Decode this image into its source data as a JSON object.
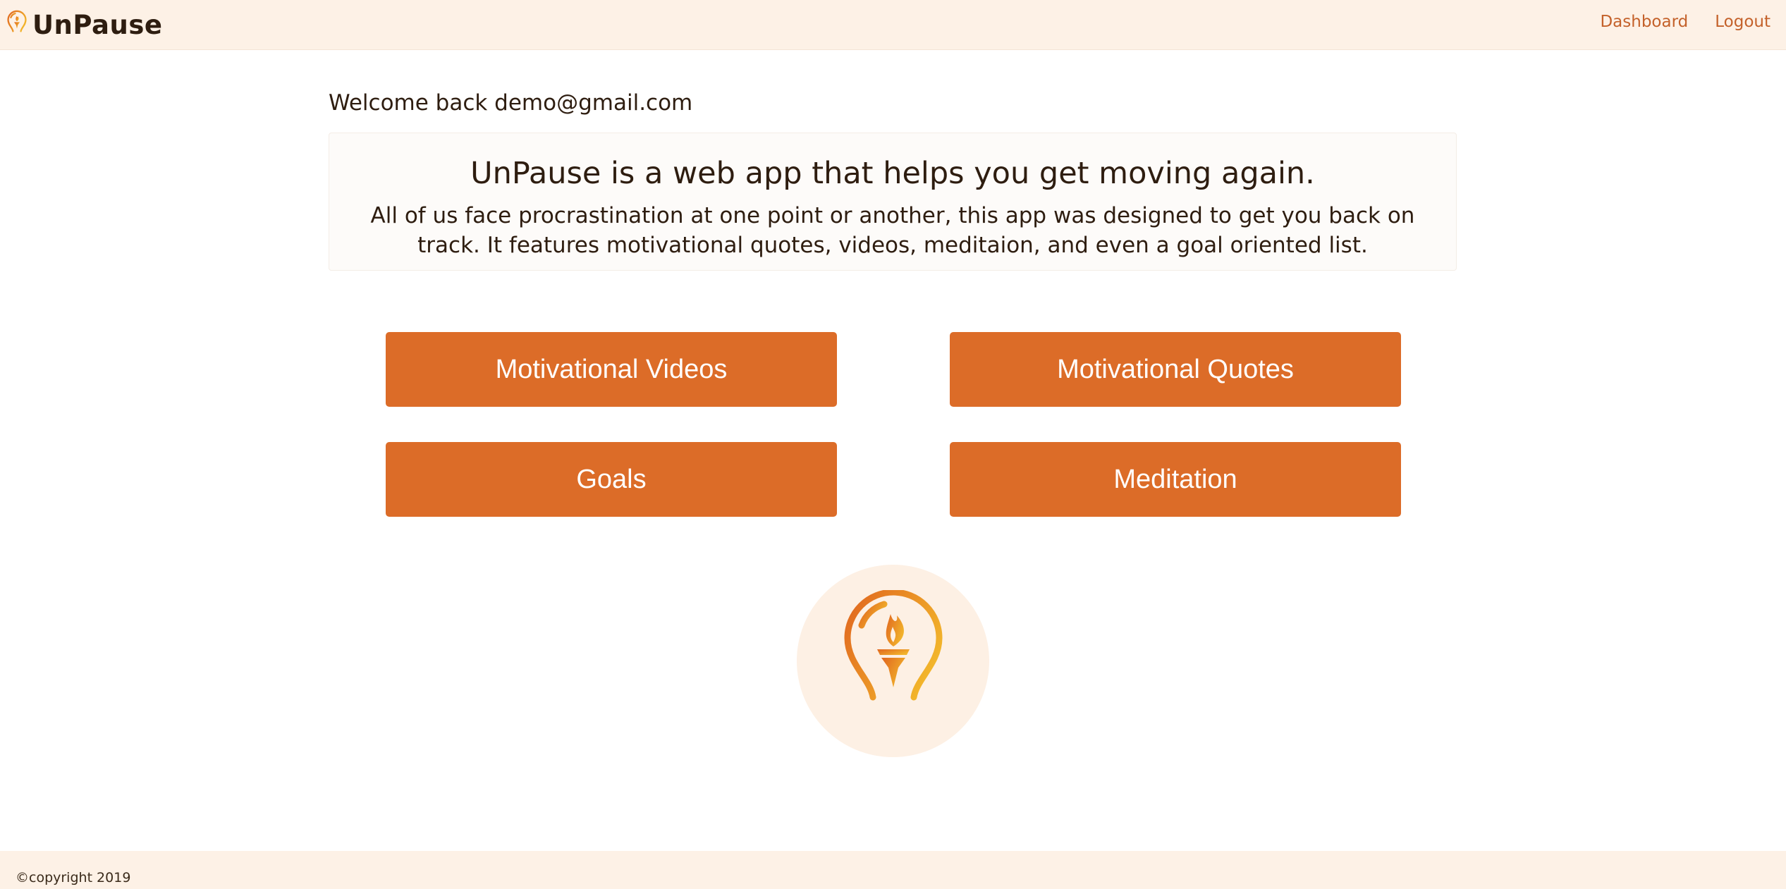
{
  "brand": {
    "name": "UnPause",
    "icon": "lightbulb-torch-icon"
  },
  "nav": {
    "dashboard_label": "Dashboard",
    "logout_label": "Logout"
  },
  "welcome": {
    "text": "Welcome back demo@gmail.com"
  },
  "intro": {
    "title": "UnPause is a web app that helps you get moving again.",
    "description": "All of us face procrastination at one point or another, this app was designed to get you back on track. It features motivational quotes, videos, meditaion, and even a goal oriented list."
  },
  "actions": {
    "videos_label": "Motivational Videos",
    "quotes_label": "Motivational Quotes",
    "goals_label": "Goals",
    "meditation_label": "Meditation"
  },
  "logo": {
    "icon": "lightbulb-torch-icon"
  },
  "footer": {
    "copyright": "©copyright 2019"
  },
  "colors": {
    "accent": "#dc6c28",
    "nav_link": "#c4612a",
    "header_bg": "#fdf1e6",
    "logo_gradient_start": "#e0651f",
    "logo_gradient_end": "#f2b52b"
  }
}
